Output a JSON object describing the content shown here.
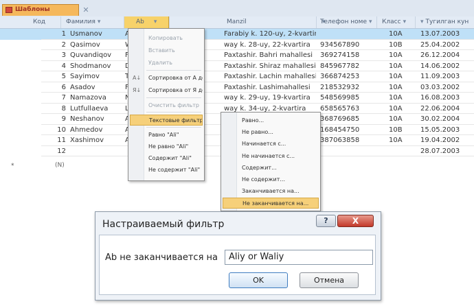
{
  "tab": {
    "title": "Шаблоны"
  },
  "headers": [
    {
      "label": "Код",
      "sort": ""
    },
    {
      "label": "Фамилия",
      "sort": "▾"
    },
    {
      "label": "Ab",
      "sort": "▾"
    },
    {
      "label": "Manzil",
      "sort": "▾"
    },
    {
      "label": "Телефон номе",
      "sort": "▾"
    },
    {
      "label": "Класс",
      "sort": "▾"
    },
    {
      "label": "Тугилган кун",
      "sort": "▾"
    }
  ],
  "rows": [
    {
      "num": "1",
      "fam": "Usmanov",
      "ab": "Ali",
      "manzil": "Farabiy k. 120-uy, 2-kvartira",
      "tel": "",
      "sinf": "10A",
      "date": "13.07.2003"
    },
    {
      "num": "2",
      "fam": "Qasimov",
      "ab": "Wi",
      "manzil": "way k. 28-uy, 22-kvartira",
      "tel": "934567890",
      "sinf": "10B",
      "date": "25.04.2002"
    },
    {
      "num": "3",
      "fam": "Quvandiqov",
      "ab": "Fa",
      "manzil": "Paxtashir. Bahri mahallesi",
      "tel": "369274158",
      "sinf": "10A",
      "date": "26.12.2004"
    },
    {
      "num": "4",
      "fam": "Shodmanov",
      "ab": "Di",
      "manzil": "Paxtashir. Shiraz mahallesi",
      "tel": "845967782",
      "sinf": "10A",
      "date": "14.06.2002"
    },
    {
      "num": "5",
      "fam": "Sayimov",
      "ab": "Ta",
      "manzil": "Paxtashir. Lachin mahallesi",
      "tel": "366874253",
      "sinf": "10A",
      "date": "11.09.2003"
    },
    {
      "num": "6",
      "fam": "Asadov",
      "ab": "Fe",
      "manzil": "Paxtashir. Lashimahallesi",
      "tel": "218532932",
      "sinf": "10A",
      "date": "03.03.2002"
    },
    {
      "num": "7",
      "fam": "Namazova",
      "ab": "Ne",
      "manzil": "way k. 29-uy, 19-kvartira",
      "tel": "548569985",
      "sinf": "10A",
      "date": "16.08.2003"
    },
    {
      "num": "8",
      "fam": "Lutfullaeva",
      "ab": "Laz",
      "manzil": "way k. 34-uy, 2-kvartira",
      "tel": "658565763",
      "sinf": "10A",
      "date": "22.06.2004"
    },
    {
      "num": "9",
      "fam": "Neshanov",
      "ab": "Aa",
      "manzil": "",
      "tel": "368769685",
      "sinf": "10A",
      "date": "30.02.2004"
    },
    {
      "num": "10",
      "fam": "Ahmedov",
      "ab": "Ah",
      "manzil": "",
      "tel": "168454750",
      "sinf": "10B",
      "date": "15.05.2003"
    },
    {
      "num": "11",
      "fam": "Xashimov",
      "ab": "Ali",
      "manzil": "",
      "tel": "387063858",
      "sinf": "10A",
      "date": "19.04.2002"
    },
    {
      "num": "12",
      "fam": "",
      "ab": "",
      "manzil": "",
      "tel": "",
      "sinf": "",
      "date": "28.07.2003"
    }
  ],
  "new_row": {
    "marker": "*",
    "label": "(N)"
  },
  "menu": {
    "items": [
      {
        "label": "Копировать",
        "icon": "",
        "state": "dim"
      },
      {
        "label": "Вставить",
        "icon": "",
        "state": "dim"
      },
      {
        "label": "Удалить",
        "icon": "",
        "state": "dim"
      },
      {
        "label": "Сортировка от А до Я",
        "icon": "A↓",
        "state": "normal"
      },
      {
        "label": "Сортировка от Я до А",
        "icon": "Я↓",
        "state": "normal"
      },
      {
        "label": "Очистить фильтр",
        "icon": "",
        "state": "dim"
      },
      {
        "label": "Текстовые фильтры",
        "icon": "",
        "state": "hi"
      },
      {
        "label": "Равно \"Ali\"",
        "icon": "",
        "state": "normal"
      },
      {
        "label": "Не равно \"Ali\"",
        "icon": "",
        "state": "normal"
      },
      {
        "label": "Содержит \"Ali\"",
        "icon": "",
        "state": "normal"
      },
      {
        "label": "Не содержит \"Ali\"",
        "icon": "",
        "state": "normal"
      }
    ]
  },
  "submenu": {
    "items": [
      {
        "label": "Равно...",
        "state": "normal"
      },
      {
        "label": "Не равно...",
        "state": "normal"
      },
      {
        "label": "Начинается с...",
        "state": "normal"
      },
      {
        "label": "Не начинается с...",
        "state": "normal"
      },
      {
        "label": "Содержит...",
        "state": "normal"
      },
      {
        "label": "Не содержит...",
        "state": "normal"
      },
      {
        "label": "Заканчивается на...",
        "state": "normal"
      },
      {
        "label": "Не заканчивается на...",
        "state": "hi"
      }
    ]
  },
  "dialog": {
    "title": "Настраиваемый фильтр",
    "help_label": "?",
    "close_label": "X",
    "condition_label": "Ab не заканчивается на",
    "input_value": "Aliy or Waliy",
    "ok_label": "OK",
    "cancel_label": "Отмена"
  },
  "colors": {
    "selected_row": "#bfe0f7",
    "highlight": "#f6d07a",
    "tab_orange": "#f5b85c"
  }
}
